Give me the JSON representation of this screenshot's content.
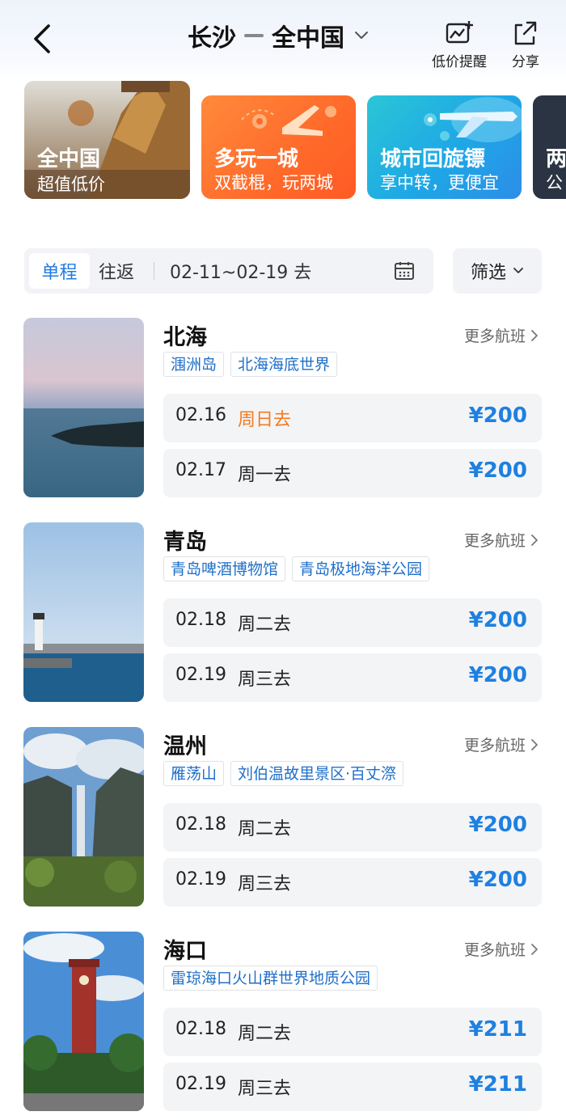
{
  "header": {
    "origin": "长沙",
    "destination": "全中国",
    "price_alert_label": "低价提醒",
    "share_label": "分享"
  },
  "themes": [
    {
      "title": "全中国",
      "subtitle": "超值低价"
    },
    {
      "title": "多玩一城",
      "subtitle": "双截棍，玩两城"
    },
    {
      "title": "城市回旋镖",
      "subtitle": "享中转，更便宜"
    },
    {
      "title": "两",
      "subtitle": "公"
    }
  ],
  "filter": {
    "one_way": "单程",
    "round_trip": "往返",
    "date_range": "02-11~02-19 去",
    "filter_label": "筛选"
  },
  "more_flights_label": "更多航班",
  "destinations": [
    {
      "name": "北海",
      "tags": [
        "涠洲岛",
        "北海海底世界"
      ],
      "fares": [
        {
          "date": "02.16",
          "day": "周日去",
          "price": "¥200",
          "highlight": true
        },
        {
          "date": "02.17",
          "day": "周一去",
          "price": "¥200",
          "highlight": false
        }
      ]
    },
    {
      "name": "青岛",
      "tags": [
        "青岛啤酒博物馆",
        "青岛极地海洋公园"
      ],
      "fares": [
        {
          "date": "02.18",
          "day": "周二去",
          "price": "¥200"
        },
        {
          "date": "02.19",
          "day": "周三去",
          "price": "¥200"
        }
      ]
    },
    {
      "name": "温州",
      "tags": [
        "雁荡山",
        "刘伯温故里景区·百丈漈"
      ],
      "fares": [
        {
          "date": "02.18",
          "day": "周二去",
          "price": "¥200"
        },
        {
          "date": "02.19",
          "day": "周三去",
          "price": "¥200"
        }
      ]
    },
    {
      "name": "海口",
      "tags": [
        "雷琼海口火山群世界地质公园"
      ],
      "fares": [
        {
          "date": "02.18",
          "day": "周二去",
          "price": "¥211"
        },
        {
          "date": "02.19",
          "day": "周三去",
          "price": "¥211"
        }
      ]
    }
  ],
  "colors": {
    "accent_blue": "#1e80e0",
    "highlight_orange": "#f47a1f",
    "tag_text": "#1f6fc9"
  }
}
